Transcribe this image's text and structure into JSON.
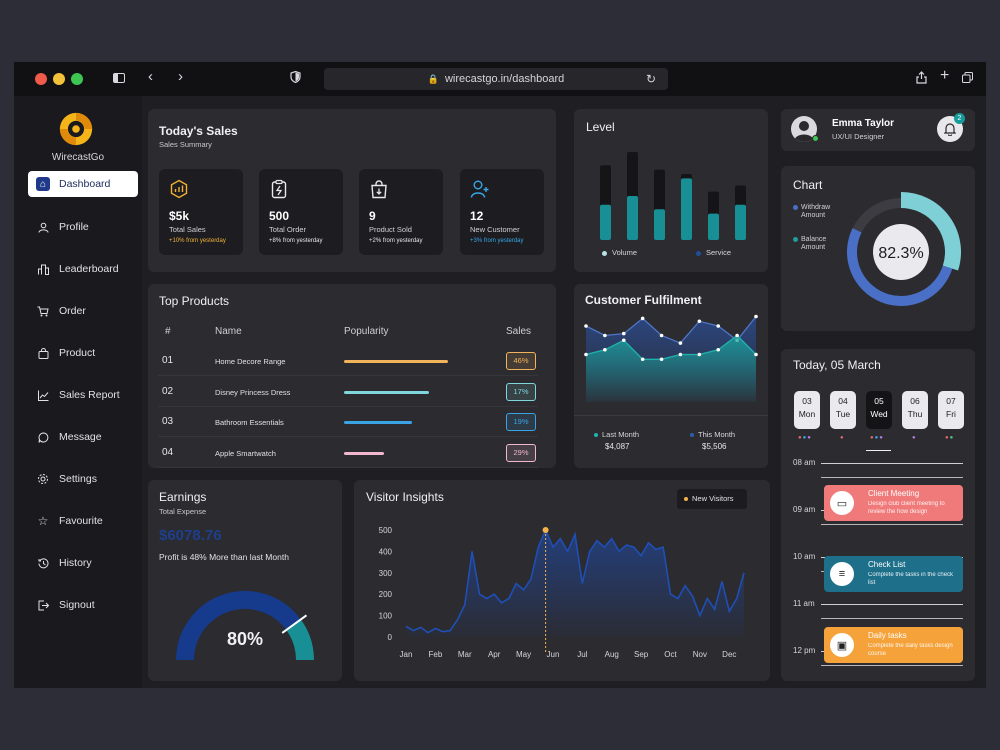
{
  "browser": {
    "url": "wirecastgo.in/dashboard"
  },
  "sidebar": {
    "brand": "WirecastGo",
    "items": [
      {
        "label": "Dashboard",
        "icon": "home-icon",
        "active": true
      },
      {
        "label": "Profile",
        "icon": "user-icon"
      },
      {
        "label": "Leaderboard",
        "icon": "leaderboard-icon"
      },
      {
        "label": "Order",
        "icon": "cart-icon"
      },
      {
        "label": "Product",
        "icon": "bag-icon"
      },
      {
        "label": "Sales Report",
        "icon": "line-chart-icon"
      },
      {
        "label": "Message",
        "icon": "message-icon"
      },
      {
        "label": "Settings",
        "icon": "gear-icon"
      },
      {
        "label": "Favourite",
        "icon": "star-icon"
      },
      {
        "label": "History",
        "icon": "history-icon"
      },
      {
        "label": "Signout",
        "icon": "signout-icon"
      }
    ]
  },
  "todays_sales": {
    "title": "Today's Sales",
    "subtitle": "Sales Summary",
    "stats": [
      {
        "value": "$5k",
        "label": "Total Sales",
        "change": "+10% from yesterday",
        "color": "#f2b134",
        "icon": "sales-chart-icon"
      },
      {
        "value": "500",
        "label": "Total Order",
        "change": "+8% from yesterday",
        "color": "#e8e8ec",
        "icon": "order-clipboard-icon"
      },
      {
        "value": "9",
        "label": "Product Sold",
        "change": "+2% from yesterday",
        "color": "#e8e8ec",
        "icon": "shopping-bag-icon"
      },
      {
        "value": "12",
        "label": "New Customer",
        "change": "+3% from yesterday",
        "color": "#35a8e8",
        "icon": "add-user-icon"
      }
    ]
  },
  "level": {
    "title": "Level",
    "legend": [
      "Volume",
      "Service"
    ]
  },
  "user": {
    "name": "Emma Taylor",
    "role": "UX/UI Designer",
    "notifications": "2"
  },
  "top_products": {
    "title": "Top Products",
    "headers": [
      "#",
      "Name",
      "Popularity",
      "Sales"
    ],
    "rows": [
      {
        "num": "01",
        "name": "Home Decore Range",
        "popularity": 0.8,
        "sales": "46%",
        "color": "#f2b45a"
      },
      {
        "num": "02",
        "name": "Disney Princess Dress",
        "popularity": 0.65,
        "sales": "17%",
        "color": "#7fd6dc"
      },
      {
        "num": "03",
        "name": "Bathroom Essentials",
        "popularity": 0.52,
        "sales": "19%",
        "color": "#3aa3e6"
      },
      {
        "num": "04",
        "name": "Apple Smartwatch",
        "popularity": 0.31,
        "sales": "29%",
        "color": "#f1b8d0"
      }
    ]
  },
  "customer_fulfilment": {
    "title": "Customer Fulfilment",
    "last_month_label": "Last Month",
    "last_month_value": "$4,087",
    "this_month_label": "This Month",
    "this_month_value": "$5,506"
  },
  "chart_card": {
    "title": "Chart",
    "legend": [
      "Withdraw Amount",
      "Balance Amount"
    ],
    "center": "82.3%"
  },
  "earnings": {
    "title": "Earnings",
    "subtitle": "Total Expense",
    "amount": "$6078.76",
    "note": "Profit is 48% More than last Month",
    "gauge": "80%"
  },
  "calendar": {
    "title": "Today, 05 March",
    "days": [
      {
        "num": "03",
        "name": "Mon",
        "dots": [
          "#e36a6a",
          "#35a8e8",
          "#b07fe0"
        ]
      },
      {
        "num": "04",
        "name": "Tue",
        "dots": [
          "#e36a6a"
        ]
      },
      {
        "num": "05",
        "name": "Wed",
        "dots": [
          "#e36a6a",
          "#35a8e8",
          "#b07fe0"
        ],
        "selected": true
      },
      {
        "num": "06",
        "name": "Thu",
        "dots": [
          "#b07fe0"
        ]
      },
      {
        "num": "07",
        "name": "Fri",
        "dots": [
          "#e36a6a",
          "#5bc08a"
        ]
      }
    ],
    "times": [
      "08 am",
      "09 am",
      "10 am",
      "11 am",
      "12 pm"
    ],
    "events": [
      {
        "title": "Client Meeting",
        "desc": "Design club client meeting to review the how design",
        "color": "#f07a7a",
        "icon": "video-icon"
      },
      {
        "title": "Check List",
        "desc": "Complete the tasks in the check list",
        "color": "#1d6f8a",
        "icon": "checklist-icon"
      },
      {
        "title": "Daily tasks",
        "desc": "Complete the daily tasks design course",
        "color": "#f5a23a",
        "icon": "task-icon"
      }
    ]
  },
  "chart_data": [
    {
      "type": "bar",
      "title": "Level",
      "categories": [
        "1",
        "2",
        "3",
        "4",
        "5",
        "6"
      ],
      "series": [
        {
          "name": "Volume",
          "values": [
            100,
            100,
            100,
            100,
            100,
            100
          ]
        },
        {
          "name": "Service",
          "values": [
            40,
            50,
            35,
            70,
            30,
            40
          ]
        }
      ]
    },
    {
      "type": "area",
      "title": "Customer Fulfilment",
      "x": [
        1,
        2,
        3,
        4,
        5,
        6,
        7,
        8,
        9,
        10
      ],
      "series": [
        {
          "name": "Last Month",
          "values": [
            80,
            70,
            72,
            88,
            70,
            62,
            85,
            80,
            65,
            90
          ]
        },
        {
          "name": "This Month",
          "values": [
            50,
            55,
            65,
            45,
            45,
            50,
            50,
            55,
            70,
            50
          ]
        }
      ]
    },
    {
      "type": "pie",
      "title": "Chart",
      "categories": [
        "Withdraw Amount",
        "Balance Amount"
      ],
      "values": [
        30,
        52.3
      ],
      "center_label": "82.3%"
    },
    {
      "type": "area",
      "title": "Visitor Insights",
      "legend": [
        "New Visitors"
      ],
      "categories": [
        "Jan",
        "Feb",
        "Mar",
        "Apr",
        "May",
        "Jun",
        "Jul",
        "Aug",
        "Sep",
        "Oct",
        "Nov",
        "Dec"
      ],
      "ylim": [
        0,
        500
      ],
      "yticks": [
        0,
        100,
        200,
        300,
        400,
        500
      ],
      "x": [
        0,
        0.25,
        0.5,
        0.75,
        1,
        1.25,
        1.5,
        1.75,
        2,
        2.25,
        2.5,
        2.75,
        3,
        3.25,
        3.5,
        3.75,
        4,
        4.25,
        4.5,
        4.75,
        5,
        5.25,
        5.5,
        5.75,
        6,
        6.25,
        6.5,
        6.75,
        7,
        7.25,
        7.5,
        7.75,
        8,
        8.25,
        8.5,
        8.75,
        9,
        9.25,
        9.5,
        9.75,
        10,
        10.25,
        10.5,
        10.75,
        11,
        11.25,
        11.5
      ],
      "values": [
        50,
        30,
        45,
        20,
        40,
        25,
        30,
        80,
        150,
        400,
        200,
        180,
        200,
        160,
        180,
        250,
        220,
        270,
        420,
        500,
        420,
        460,
        400,
        480,
        250,
        400,
        450,
        420,
        460,
        400,
        430,
        420,
        380,
        440,
        410,
        420,
        200,
        180,
        240,
        190,
        100,
        180,
        130,
        260,
        120,
        180,
        300
      ]
    }
  ]
}
